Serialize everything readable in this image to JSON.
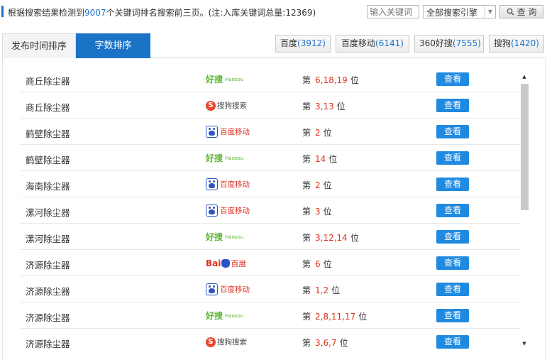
{
  "summary": {
    "prefix": "根据搜索结果检测到",
    "count": "9007",
    "suffix": "个关键词排名搜索前三页。(注:入库关键词总量:12369)"
  },
  "search": {
    "placeholder": "输入关键词",
    "scope": "全部搜索引擎",
    "query_label": "查 询"
  },
  "tabs": [
    {
      "label": "发布时间排序",
      "active": false
    },
    {
      "label": "字数排序",
      "active": true
    }
  ],
  "engines": [
    {
      "name": "百度",
      "count": "(3912)"
    },
    {
      "name": "百度移动",
      "count": "(6141)"
    },
    {
      "name": "360好搜",
      "count": "(7555)"
    },
    {
      "name": "搜狗",
      "count": "(1420)"
    }
  ],
  "rank_prefix": "第",
  "rank_suffix": "位",
  "view_label": "查看",
  "rows": [
    {
      "keyword": "商丘除尘器",
      "engine": "haosou",
      "logo_text": "好搜",
      "logo_sub": "Haosou",
      "positions": "6,18,19"
    },
    {
      "keyword": "商丘除尘器",
      "engine": "sogou",
      "logo_text": "搜狗搜索",
      "logo_sub": "",
      "positions": "3,13"
    },
    {
      "keyword": "鹤壁除尘器",
      "engine": "baidu-mobile",
      "logo_text": "百度移动",
      "logo_sub": "",
      "positions": "2"
    },
    {
      "keyword": "鹤壁除尘器",
      "engine": "haosou",
      "logo_text": "好搜",
      "logo_sub": "Haosou",
      "positions": "14"
    },
    {
      "keyword": "海南除尘器",
      "engine": "baidu-mobile",
      "logo_text": "百度移动",
      "logo_sub": "",
      "positions": "2"
    },
    {
      "keyword": "漯河除尘器",
      "engine": "baidu-mobile",
      "logo_text": "百度移动",
      "logo_sub": "",
      "positions": "3"
    },
    {
      "keyword": "漯河除尘器",
      "engine": "haosou",
      "logo_text": "好搜",
      "logo_sub": "Haosou",
      "positions": "3,12,14"
    },
    {
      "keyword": "济源除尘器",
      "engine": "baidu",
      "logo_text": "百度",
      "logo_sub": "Bai",
      "positions": "6"
    },
    {
      "keyword": "济源除尘器",
      "engine": "baidu-mobile",
      "logo_text": "百度移动",
      "logo_sub": "",
      "positions": "1,2"
    },
    {
      "keyword": "济源除尘器",
      "engine": "haosou",
      "logo_text": "好搜",
      "logo_sub": "Haosou",
      "positions": "2,8,11,17"
    },
    {
      "keyword": "济源除尘器",
      "engine": "sogou",
      "logo_text": "搜狗搜索",
      "logo_sub": "",
      "positions": "3,6,7"
    }
  ],
  "colors": {
    "accent": "#1a73c7",
    "button": "#1f8ae0",
    "rank": "#e0321c",
    "haosou": "#5cb531",
    "sogou": "#e8462e",
    "baidu_red": "#de2f22",
    "baidu_blue": "#2b54c8"
  }
}
